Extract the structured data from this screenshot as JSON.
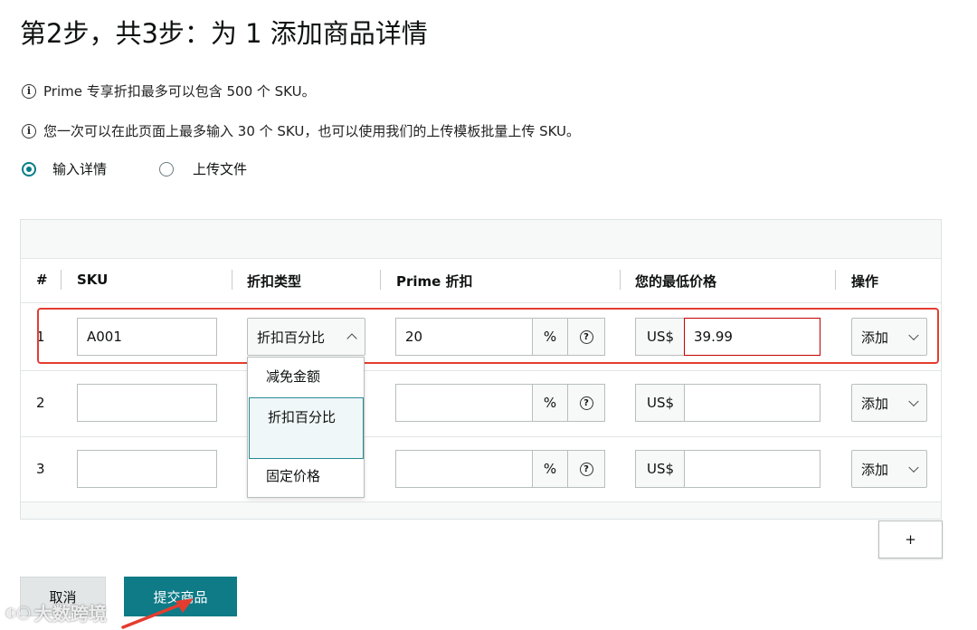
{
  "page": {
    "title": "第2步，共3步：为 1 添加商品详情",
    "info": [
      "Prime 专享折扣最多可以包含 500 个 SKU。",
      "您一次可以在此页面上最多输入 30 个 SKU，也可以使用我们的上传模板批量上传 SKU。"
    ],
    "mode_options": [
      {
        "label": "输入详情",
        "selected": true
      },
      {
        "label": "上传文件",
        "selected": false
      }
    ]
  },
  "table": {
    "headers": [
      "#",
      "SKU",
      "折扣类型",
      "Prime 折扣",
      "您的最低价格",
      "操作"
    ],
    "percent_symbol": "%",
    "currency": "US$",
    "rows": [
      {
        "num": "1",
        "sku": "A001",
        "discount_type": "折扣百分比",
        "prime_discount": "20",
        "min_price": "39.99",
        "action": "添加"
      },
      {
        "num": "2",
        "sku": "",
        "discount_type": "",
        "prime_discount": "",
        "min_price": "",
        "action": "添加"
      },
      {
        "num": "3",
        "sku": "",
        "discount_type": "",
        "prime_discount": "",
        "min_price": "",
        "action": "添加"
      }
    ],
    "dropdown_options": [
      "减免金额",
      "折扣百分比",
      "固定价格"
    ],
    "dropdown_selected": "折扣百分比",
    "add_row": "+"
  },
  "buttons": {
    "cancel": "取消",
    "submit": "提交商品"
  },
  "watermark": "大数跨境",
  "colors": {
    "accent": "#067d86",
    "submit_bg": "#0e7b87",
    "highlight": "#e43d30",
    "error_border": "#c40000"
  }
}
